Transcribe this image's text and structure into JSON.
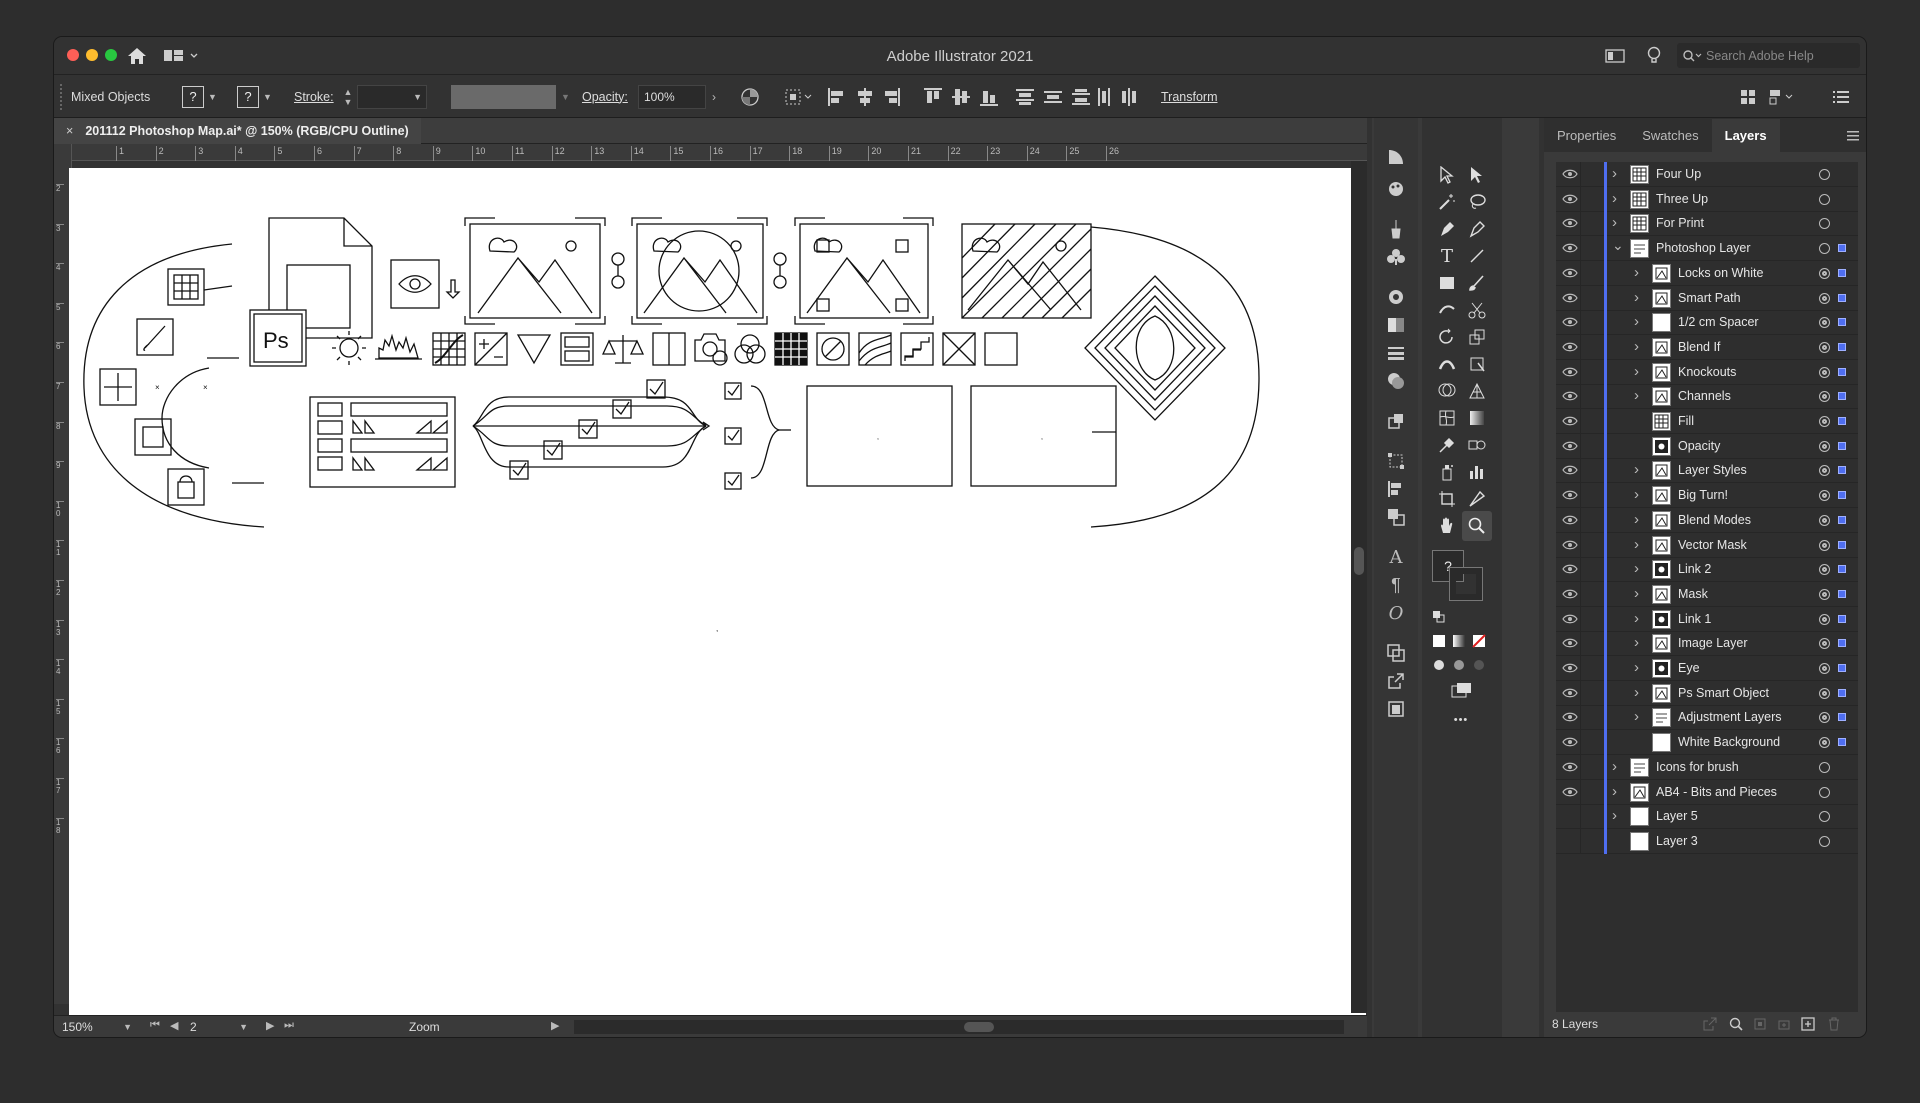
{
  "app": {
    "title": "Adobe Illustrator 2021",
    "search_placeholder": "Search Adobe Help"
  },
  "control_bar": {
    "selection_label": "Mixed Objects",
    "fill_glyph": "?",
    "stroke_glyph": "?",
    "stroke_label": "Stroke:",
    "opacity_label": "Opacity:",
    "opacity_value": "100%",
    "transform_label": "Transform"
  },
  "document": {
    "tab_title": "201112 Photoshop Map.ai* @ 150% (RGB/CPU Outline)",
    "close_glyph": "×"
  },
  "ruler": {
    "h_ticks": [
      "1",
      "2",
      "3",
      "4",
      "5",
      "6",
      "7",
      "8",
      "9",
      "10",
      "11",
      "12",
      "13",
      "14",
      "15",
      "16",
      "17",
      "18",
      "19",
      "20",
      "21",
      "22",
      "23",
      "24",
      "25",
      "26"
    ],
    "v_ticks": [
      "2",
      "3",
      "4",
      "5",
      "6",
      "7",
      "8",
      "9",
      "10",
      "11",
      "12",
      "13",
      "14",
      "15",
      "16",
      "17",
      "18"
    ]
  },
  "canvas": {
    "ps_badge": "Ps"
  },
  "statusbar": {
    "zoom": "150%",
    "artboard_number": "2",
    "tool_label": "Zoom"
  },
  "tools": {
    "help_glyph": "?",
    "more_glyph": "•••"
  },
  "panel": {
    "tabs": [
      "Properties",
      "Swatches",
      "Layers"
    ],
    "active_tab": "Layers",
    "layer_count": "8 Layers",
    "layers": [
      {
        "name": "Four Up",
        "depth": 0,
        "expander": "closed",
        "visible": true,
        "thumb": "grid"
      },
      {
        "name": "Three Up",
        "depth": 0,
        "expander": "closed",
        "visible": true,
        "thumb": "grid"
      },
      {
        "name": "For Print",
        "depth": 0,
        "expander": "closed",
        "visible": true,
        "thumb": "grid"
      },
      {
        "name": "Photoshop Layer",
        "depth": 0,
        "expander": "open",
        "visible": true,
        "thumb": "lines"
      },
      {
        "name": "Locks on White",
        "depth": 1,
        "expander": "closed",
        "visible": true,
        "thumb": "icon"
      },
      {
        "name": "Smart Path",
        "depth": 1,
        "expander": "closed",
        "visible": true,
        "thumb": "icon"
      },
      {
        "name": "1/2 cm Spacer",
        "depth": 1,
        "expander": "closed",
        "visible": true,
        "thumb": "blank"
      },
      {
        "name": "Blend If",
        "depth": 1,
        "expander": "closed",
        "visible": true,
        "thumb": "icon"
      },
      {
        "name": "Knockouts",
        "depth": 1,
        "expander": "closed",
        "visible": true,
        "thumb": "icon"
      },
      {
        "name": "Channels",
        "depth": 1,
        "expander": "closed",
        "visible": true,
        "thumb": "icon"
      },
      {
        "name": "Fill",
        "depth": 1,
        "expander": "none",
        "visible": true,
        "thumb": "grid"
      },
      {
        "name": "Opacity",
        "depth": 1,
        "expander": "none",
        "visible": true,
        "thumb": "dark"
      },
      {
        "name": "Layer Styles",
        "depth": 1,
        "expander": "closed",
        "visible": true,
        "thumb": "icon"
      },
      {
        "name": "Big Turn!",
        "depth": 1,
        "expander": "closed",
        "visible": true,
        "thumb": "icon"
      },
      {
        "name": "Blend Modes",
        "depth": 1,
        "expander": "closed",
        "visible": true,
        "thumb": "icon"
      },
      {
        "name": "Vector Mask",
        "depth": 1,
        "expander": "closed",
        "visible": true,
        "thumb": "icon"
      },
      {
        "name": "Link 2",
        "depth": 1,
        "expander": "closed",
        "visible": true,
        "thumb": "dark"
      },
      {
        "name": "Mask",
        "depth": 1,
        "expander": "closed",
        "visible": true,
        "thumb": "icon"
      },
      {
        "name": "Link 1",
        "depth": 1,
        "expander": "closed",
        "visible": true,
        "thumb": "dark"
      },
      {
        "name": "Image Layer",
        "depth": 1,
        "expander": "closed",
        "visible": true,
        "thumb": "icon"
      },
      {
        "name": "Eye",
        "depth": 1,
        "expander": "closed",
        "visible": true,
        "thumb": "dark"
      },
      {
        "name": "Ps Smart Object",
        "depth": 1,
        "expander": "closed",
        "visible": true,
        "thumb": "icon"
      },
      {
        "name": "Adjustment Layers",
        "depth": 1,
        "expander": "closed",
        "visible": true,
        "thumb": "lines"
      },
      {
        "name": "White Background",
        "depth": 1,
        "expander": "none",
        "visible": true,
        "thumb": "blank"
      },
      {
        "name": "Icons for brush",
        "depth": 0,
        "expander": "closed",
        "visible": true,
        "thumb": "lines"
      },
      {
        "name": "AB4 - Bits and Pieces",
        "depth": 0,
        "expander": "closed",
        "visible": true,
        "thumb": "icon"
      },
      {
        "name": "Layer 5",
        "depth": 0,
        "expander": "closed",
        "visible": false,
        "thumb": "blank"
      },
      {
        "name": "Layer 3",
        "depth": 0,
        "expander": "none",
        "visible": false,
        "thumb": "blank"
      }
    ]
  }
}
